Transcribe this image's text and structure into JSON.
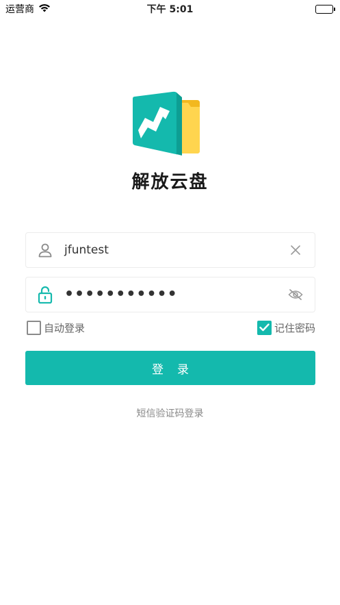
{
  "status_bar": {
    "carrier": "运营商",
    "time": "下午 5:01",
    "wifi_icon": "wifi-icon",
    "battery_icon": "battery-icon"
  },
  "branding": {
    "app_name": "解放云盘",
    "logo_icon": "app-logo-icon",
    "logo_colors": {
      "teal": "#14b9ad",
      "yellow": "#ffd24d",
      "yellow_dark": "#f2b81f"
    }
  },
  "login_form": {
    "username": {
      "value": "jfuntest",
      "icon": "user-icon",
      "clear_icon": "clear-icon"
    },
    "password": {
      "masked_value": "•••••••••••",
      "icon": "unlocked-padlock-icon",
      "visibility_icon": "eye-off-icon"
    },
    "auto_login": {
      "label": "自动登录",
      "checked": false
    },
    "remember_password": {
      "label": "记住密码",
      "checked": true
    },
    "submit_label": "登录",
    "sms_login_link": "短信验证码登录"
  },
  "colors": {
    "accent": "#14b9ad",
    "background": "#ffffff",
    "muted_text": "#888888"
  }
}
